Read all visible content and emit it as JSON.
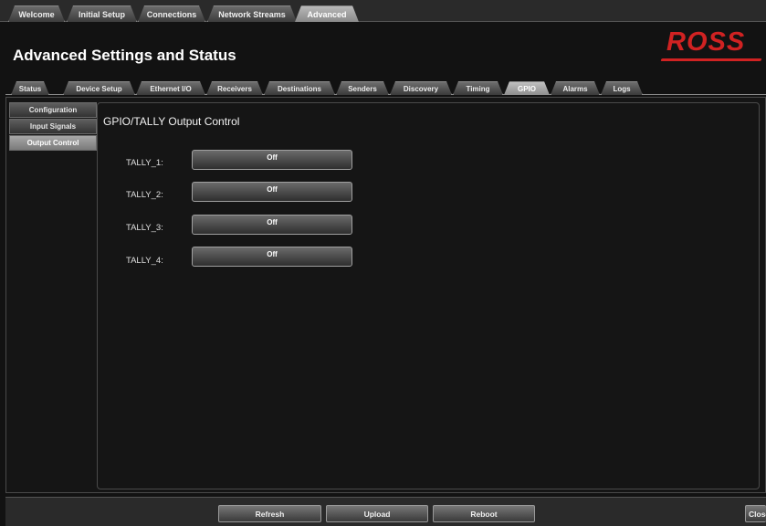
{
  "top_tabs": [
    {
      "label": "Welcome"
    },
    {
      "label": "Initial Setup"
    },
    {
      "label": "Connections"
    },
    {
      "label": "Network Streams"
    },
    {
      "label": "Advanced",
      "active": true
    }
  ],
  "header": {
    "title": "Advanced Settings and Status",
    "logo_text": "ROSS"
  },
  "sub_tabs": [
    {
      "label": "Status"
    },
    {
      "label": "Device Setup"
    },
    {
      "label": "Ethernet I/O"
    },
    {
      "label": "Receivers"
    },
    {
      "label": "Destinations"
    },
    {
      "label": "Senders"
    },
    {
      "label": "Discovery"
    },
    {
      "label": "Timing"
    },
    {
      "label": "GPIO",
      "active": true
    },
    {
      "label": "Alarms"
    },
    {
      "label": "Logs"
    }
  ],
  "side_menu": [
    {
      "label": "Configuration"
    },
    {
      "label": "Input Signals"
    },
    {
      "label": "Output Control",
      "active": true
    }
  ],
  "main": {
    "section_title": "GPIO/TALLY Output Control",
    "tallies": [
      {
        "label": "TALLY_1:",
        "state": "Off"
      },
      {
        "label": "TALLY_2:",
        "state": "Off"
      },
      {
        "label": "TALLY_3:",
        "state": "Off"
      },
      {
        "label": "TALLY_4:",
        "state": "Off"
      }
    ]
  },
  "bottom": {
    "refresh": "Refresh",
    "upload": "Upload",
    "reboot": "Reboot",
    "close": "Close"
  },
  "colors": {
    "brand_red": "#d02222",
    "background": "#121212",
    "active_tab": "#a8a8a8"
  }
}
